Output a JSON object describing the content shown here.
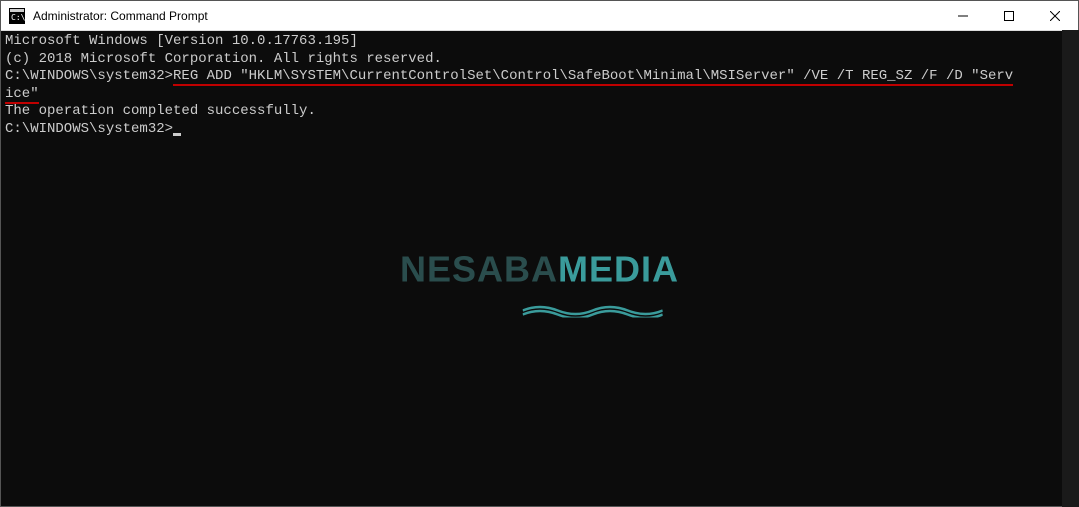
{
  "window": {
    "title": "Administrator: Command Prompt"
  },
  "terminal": {
    "line1": "Microsoft Windows [Version 10.0.17763.195]",
    "line2": "(c) 2018 Microsoft Corporation. All rights reserved.",
    "blank1": "",
    "prompt1": "C:\\WINDOWS\\system32>",
    "command_part1": "REG ADD \"HKLM\\SYSTEM\\CurrentControlSet\\Control\\SafeBoot\\Minimal\\MSIServer\" /VE /T REG_SZ /F /D \"Serv",
    "command_part2": "ice\"",
    "result": "The operation completed successfully.",
    "blank2": "",
    "prompt2": "C:\\WINDOWS\\system32>"
  },
  "watermark": {
    "part1": "NESABA",
    "part2": "MEDIA"
  }
}
